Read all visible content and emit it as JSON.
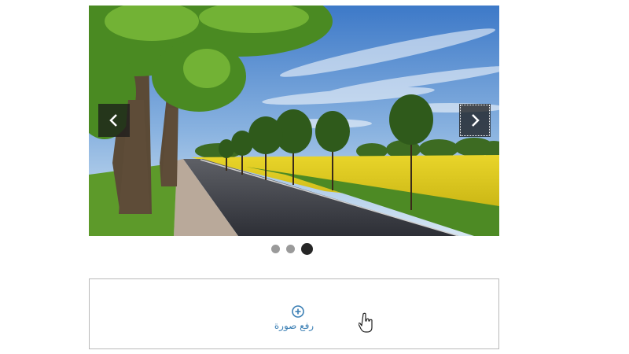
{
  "carousel": {
    "prev_icon": "chevron-left-icon",
    "next_icon": "chevron-right-icon",
    "slide_count": 3,
    "active_slide": 3,
    "image": "tree-lined-road-with-yellow-field"
  },
  "upload": {
    "icon": "plus-circle-icon",
    "label": "رفع صورة",
    "accent": "#3b7fb4"
  },
  "cursor": {
    "icon": "hand-pointer-icon"
  }
}
